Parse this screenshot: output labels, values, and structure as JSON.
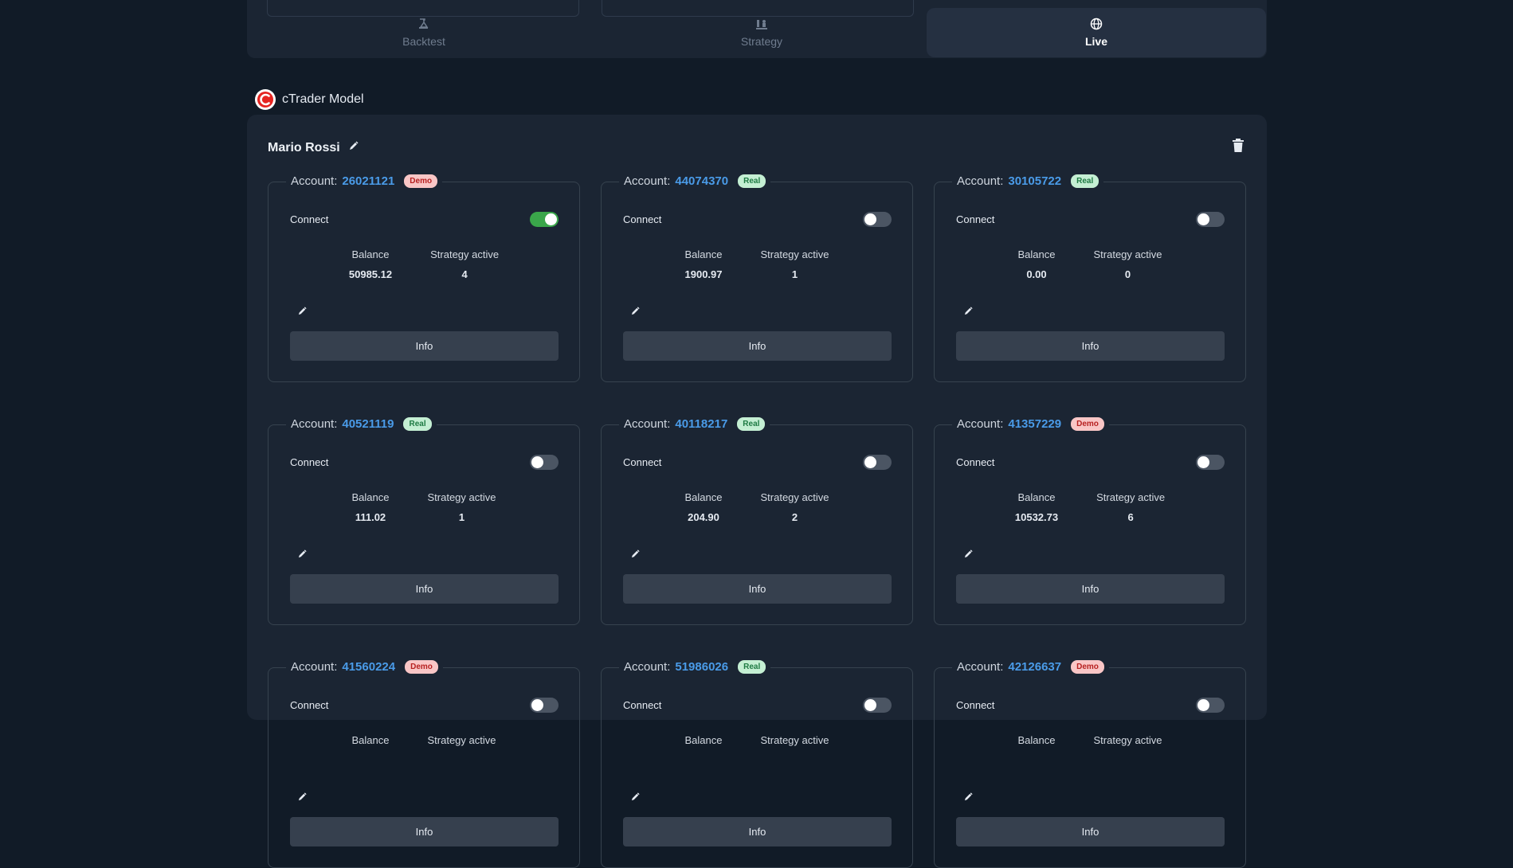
{
  "tabs": [
    {
      "label": "Backtest",
      "icon": "flask-icon",
      "active": false
    },
    {
      "label": "Strategy",
      "icon": "chess-icon",
      "active": false
    },
    {
      "label": "Live",
      "icon": "globe-icon",
      "active": true
    }
  ],
  "section": {
    "title": "cTrader Model",
    "logo": "ctrader-logo"
  },
  "owner": {
    "name": "Mario Rossi"
  },
  "labels": {
    "account": "Account:",
    "connect": "Connect",
    "balance": "Balance",
    "strategy_active": "Strategy active",
    "info_button": "Info"
  },
  "colors": {
    "background": "#111b27",
    "panel": "#1b2533",
    "accent": "#4a9be8",
    "toggle_on": "#3aa64a",
    "demo_badge": "#f9c6c6",
    "real_badge": "#c4efd3"
  },
  "accounts": [
    {
      "number": "26021121",
      "type": "Demo",
      "connected": true,
      "balance": "50985.12",
      "strategy_active": "4"
    },
    {
      "number": "44074370",
      "type": "Real",
      "connected": false,
      "balance": "1900.97",
      "strategy_active": "1"
    },
    {
      "number": "30105722",
      "type": "Real",
      "connected": false,
      "balance": "0.00",
      "strategy_active": "0"
    },
    {
      "number": "40521119",
      "type": "Real",
      "connected": false,
      "balance": "111.02",
      "strategy_active": "1"
    },
    {
      "number": "40118217",
      "type": "Real",
      "connected": false,
      "balance": "204.90",
      "strategy_active": "2"
    },
    {
      "number": "41357229",
      "type": "Demo",
      "connected": false,
      "balance": "10532.73",
      "strategy_active": "6"
    },
    {
      "number": "41560224",
      "type": "Demo",
      "connected": false,
      "balance": "",
      "strategy_active": ""
    },
    {
      "number": "51986026",
      "type": "Real",
      "connected": false,
      "balance": "",
      "strategy_active": ""
    },
    {
      "number": "42126637",
      "type": "Demo",
      "connected": false,
      "balance": "",
      "strategy_active": ""
    }
  ]
}
